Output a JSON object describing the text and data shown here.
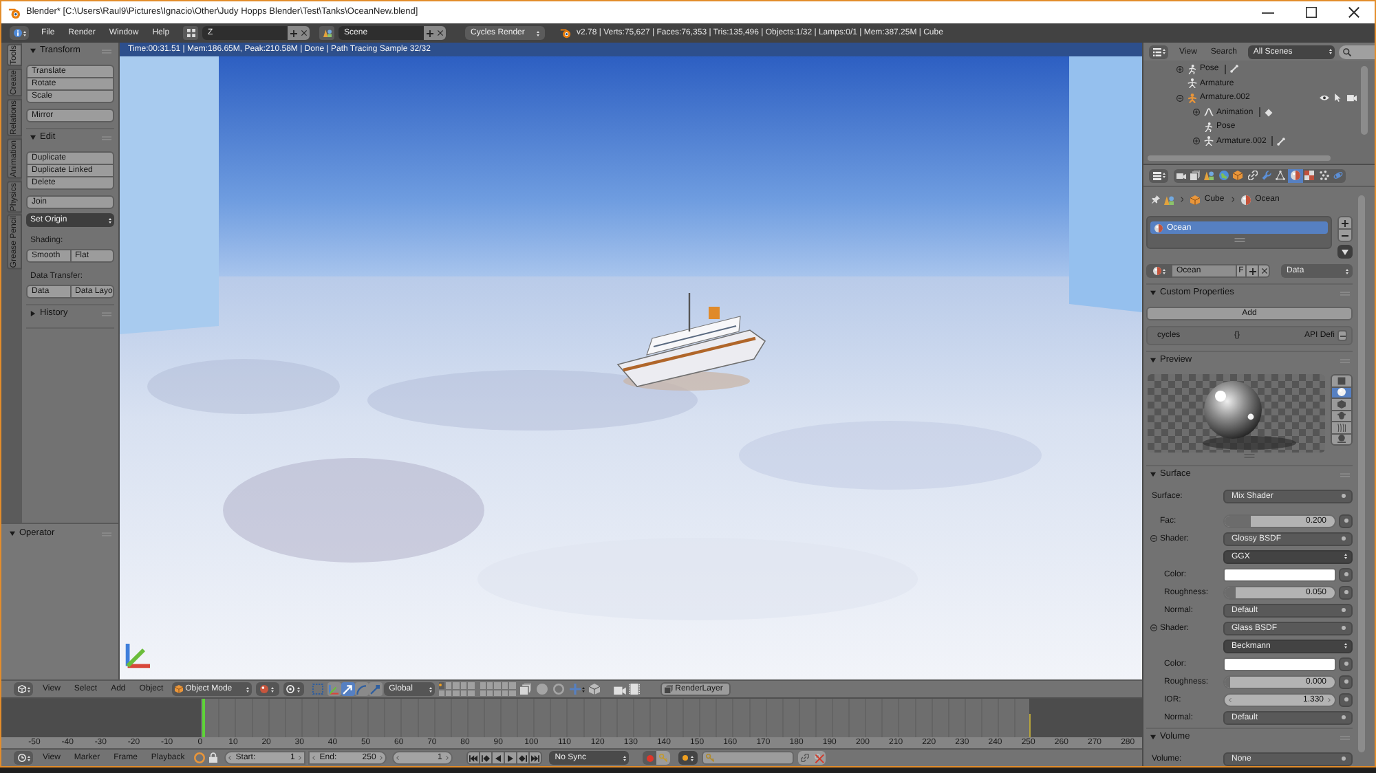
{
  "window": {
    "title": "Blender* [C:\\Users\\Raul9\\Pictures\\Ignacio\\Other\\Judy Hopps Blender\\Test\\Tanks\\OceanNew.blend]"
  },
  "info_header": {
    "menus": [
      "File",
      "Render",
      "Window",
      "Help"
    ],
    "screen_layout": "Z",
    "scene": "Scene",
    "render_engine": "Cycles Render",
    "stats": "v2.78 | Verts:75,627 | Faces:76,353 | Tris:135,496 | Objects:1/32 | Lamps:0/1 | Mem:387.25M | Cube"
  },
  "tool_shelf": {
    "tabs": [
      {
        "label": "Tools",
        "selected": true
      },
      {
        "label": "Create",
        "selected": false
      },
      {
        "label": "Relations",
        "selected": false
      },
      {
        "label": "Animation",
        "selected": false
      },
      {
        "label": "Physics",
        "selected": false
      },
      {
        "label": "Grease Pencil",
        "selected": false
      }
    ],
    "panels": [
      {
        "title": "Transform",
        "expanded": true,
        "items": [
          {
            "kind": "column",
            "buttons": [
              "Translate",
              "Rotate",
              "Scale"
            ]
          },
          {
            "kind": "column",
            "buttons": [
              "Mirror"
            ]
          }
        ]
      },
      {
        "title": "Edit",
        "expanded": true,
        "items": [
          {
            "kind": "column",
            "buttons": [
              "Duplicate",
              "Duplicate Linked",
              "Delete"
            ]
          },
          {
            "kind": "column",
            "buttons": [
              "Join"
            ]
          },
          {
            "kind": "dropdown",
            "value": "Set Origin"
          },
          {
            "kind": "label",
            "text": "Shading:"
          },
          {
            "kind": "row",
            "buttons": [
              "Smooth",
              "Flat"
            ]
          },
          {
            "kind": "label",
            "text": "Data Transfer:"
          },
          {
            "kind": "row",
            "buttons": [
              "Data",
              "Data Layo"
            ]
          }
        ]
      },
      {
        "title": "History",
        "expanded": false
      }
    ],
    "operator_panel": {
      "title": "Operator",
      "expanded": true
    }
  },
  "viewport": {
    "render_status": "Time:00:31.51 | Mem:186.65M, Peak:210.58M | Done | Path Tracing Sample 32/32"
  },
  "view3d_header": {
    "menus": [
      "View",
      "Select",
      "Add",
      "Object"
    ],
    "mode": "Object Mode",
    "manipulators": [
      {
        "kind": "axes",
        "on": false
      },
      {
        "kind": "translate",
        "on": true
      },
      {
        "kind": "rotate",
        "on": false
      },
      {
        "kind": "scale",
        "on": false
      }
    ],
    "orientation": "Global",
    "layers": [
      {
        "selected": true,
        "has_objects": true
      },
      {
        "selected": false,
        "has_objects": false
      },
      {
        "selected": false,
        "has_objects": false
      },
      {
        "selected": false,
        "has_objects": false
      },
      {
        "selected": false,
        "has_objects": false
      },
      {
        "selected": false,
        "has_objects": false
      },
      {
        "selected": false,
        "has_objects": false
      },
      {
        "selected": false,
        "has_objects": false
      },
      {
        "selected": false,
        "has_objects": false
      },
      {
        "selected": false,
        "has_objects": false
      },
      {
        "selected": false,
        "has_objects": false
      },
      {
        "selected": false,
        "has_objects": false
      },
      {
        "selected": false,
        "has_objects": false
      },
      {
        "selected": false,
        "has_objects": false
      },
      {
        "selected": false,
        "has_objects": false
      },
      {
        "selected": false,
        "has_objects": false
      },
      {
        "selected": false,
        "has_objects": false
      },
      {
        "selected": false,
        "has_objects": false
      },
      {
        "selected": false,
        "has_objects": false
      },
      {
        "selected": false,
        "has_objects": false
      }
    ],
    "render_layer": "RenderLayer"
  },
  "timeline": {
    "range_start": {
      "level": 0.175
    },
    "playhead": {
      "level": 0.176
    },
    "range_end": {
      "level": 0.901
    },
    "ruler": [
      "-50",
      "-40",
      "-30",
      "-20",
      "-10",
      "0",
      "10",
      "20",
      "30",
      "40",
      "50",
      "60",
      "70",
      "80",
      "90",
      "100",
      "110",
      "120",
      "130",
      "140",
      "150",
      "160",
      "170",
      "180",
      "190",
      "200",
      "210",
      "220",
      "230",
      "240",
      "250",
      "260",
      "270",
      "280"
    ]
  },
  "timeline_header": {
    "menus": [
      "View",
      "Marker",
      "Frame",
      "Playback"
    ],
    "start": {
      "label": "Start:",
      "value": "1"
    },
    "end": {
      "label": "End:",
      "value": "250"
    },
    "current_frame": "1",
    "sync": "No Sync"
  },
  "outliner": {
    "menus": [
      "View",
      "Search"
    ],
    "filter": "All Scenes",
    "items": [
      {
        "kind": "pose",
        "label": "Pose",
        "expanded": false,
        "trailing": {
          "kind": "bone"
        }
      },
      {
        "kind": "armature_data",
        "label": "Armature"
      },
      {
        "kind": "armature_object",
        "label": "Armature.002",
        "expanded": true,
        "restrict": true,
        "children": [
          {
            "kind": "animation",
            "label": "Animation",
            "expanded": false,
            "trailing": {
              "kind": "action"
            }
          },
          {
            "kind": "pose",
            "label": "Pose"
          },
          {
            "kind": "armature_data",
            "label": "Armature.002",
            "expanded": false,
            "trailing": {
              "kind": "bone"
            }
          }
        ]
      }
    ]
  },
  "properties": {
    "tabs": [
      {
        "kind": "render",
        "selected": false
      },
      {
        "kind": "render_layers",
        "selected": false
      },
      {
        "kind": "scene",
        "selected": false
      },
      {
        "kind": "world",
        "selected": false
      },
      {
        "kind": "object",
        "selected": false
      },
      {
        "kind": "constraints",
        "selected": false
      },
      {
        "kind": "modifiers",
        "selected": false
      },
      {
        "kind": "data",
        "selected": false
      },
      {
        "kind": "material",
        "selected": true
      },
      {
        "kind": "texture",
        "selected": false
      },
      {
        "kind": "particles",
        "selected": false
      },
      {
        "kind": "physics",
        "selected": false
      }
    ],
    "breadcrumb": [
      {
        "kind": "scene"
      },
      {
        "kind": "object",
        "label": "Cube"
      },
      {
        "kind": "material",
        "label": "Ocean"
      }
    ],
    "material_slots": [
      {
        "name": "Ocean",
        "selected": true
      }
    ],
    "material": {
      "name": "Ocean",
      "fake_user": "F",
      "link": "Data"
    },
    "panels": [
      {
        "kind": "custom_properties",
        "title": "Custom Properties",
        "expanded": true,
        "add_button": "Add",
        "property": {
          "name": "cycles",
          "value": "{}",
          "type": "API Defi"
        }
      },
      {
        "kind": "preview",
        "title": "Preview",
        "expanded": true,
        "preview_types": [
          {
            "kind": "flat",
            "selected": false
          },
          {
            "kind": "sphere",
            "selected": true
          },
          {
            "kind": "cube",
            "selected": false
          },
          {
            "kind": "monkey",
            "selected": false
          },
          {
            "kind": "hair",
            "selected": false
          },
          {
            "kind": "sphere_sky",
            "selected": false
          }
        ]
      },
      {
        "kind": "node_rows",
        "title": "Surface",
        "expanded": true,
        "rows": [
          {
            "kind": "dropdown",
            "label": "Surface:",
            "value": "Mix Shader",
            "children": [
              {
                "kind": "slider",
                "label": "Fac:",
                "value": "0.200",
                "level": 0.2
              },
              {
                "kind": "shader",
                "label": "Shader:",
                "value": "Glossy BSDF",
                "children": [
                  {
                    "kind": "enum",
                    "value": "GGX"
                  },
                  {
                    "kind": "color",
                    "label": "Color:",
                    "color": "#ffffff"
                  },
                  {
                    "kind": "slider",
                    "label": "Roughness:",
                    "value": "0.050",
                    "level": 0.05
                  },
                  {
                    "kind": "dropdown",
                    "label": "Normal:",
                    "value": "Default"
                  }
                ]
              },
              {
                "kind": "shader",
                "label": "Shader:",
                "value": "Glass BSDF",
                "children": [
                  {
                    "kind": "enum",
                    "value": "Beckmann"
                  },
                  {
                    "kind": "color",
                    "label": "Color:",
                    "color": "#ffffff"
                  },
                  {
                    "kind": "slider",
                    "label": "Roughness:",
                    "value": "0.000",
                    "level": 0
                  },
                  {
                    "kind": "number",
                    "label": "IOR:",
                    "value": "1.330"
                  },
                  {
                    "kind": "dropdown",
                    "label": "Normal:",
                    "value": "Default"
                  }
                ]
              }
            ]
          }
        ]
      },
      {
        "kind": "node_rows",
        "title": "Volume",
        "expanded": true,
        "rows": [
          {
            "kind": "dropdown",
            "label": "Volume:",
            "value": "None"
          }
        ]
      }
    ]
  }
}
